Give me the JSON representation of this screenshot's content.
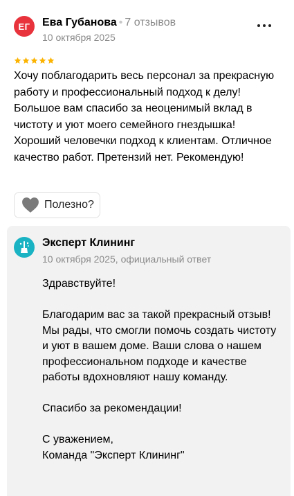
{
  "review": {
    "avatar_initials": "ЕГ",
    "avatar_color": "#e8323c",
    "author_name": "Ева Губанова",
    "separator": "•",
    "author_reviews": "7 отзывов",
    "date": "10 октября 2025",
    "rating": 5,
    "rating_max": 5,
    "star_color": "#fbb300",
    "text": "Хочу поблагодарить весь персонал за прекрасную работу и профессиональный подход к делу! Большое вам спасибо за неоценимый вклад в чистоту и уют моего семейного гнездышка! Хороший человечки подход к клиентам. Отличное качество работ. Претензий нет. Рекомендую!",
    "more_icon": "more-horizontal-icon",
    "useful_label": "Полезно?",
    "useful_icon": "heart-icon"
  },
  "answer": {
    "org_name": "Эксперт Клининг",
    "logo_color": "#19b3c4",
    "meta": "10 октября 2025, официальный ответ",
    "greeting": "Здравствуйте!",
    "paragraph": "Благодарим вас за такой прекрасный отзыв! Мы рады, что смогли помочь создать чистоту и уют в вашем доме. Ваши слова о нашем профессиональном подходе и качестве работы вдохновляют нашу команду.",
    "thanks": "Спасибо за рекомендации!",
    "closing_line1": "С уважением,",
    "closing_line2": "Команда \"Эксперт Клининг\""
  }
}
